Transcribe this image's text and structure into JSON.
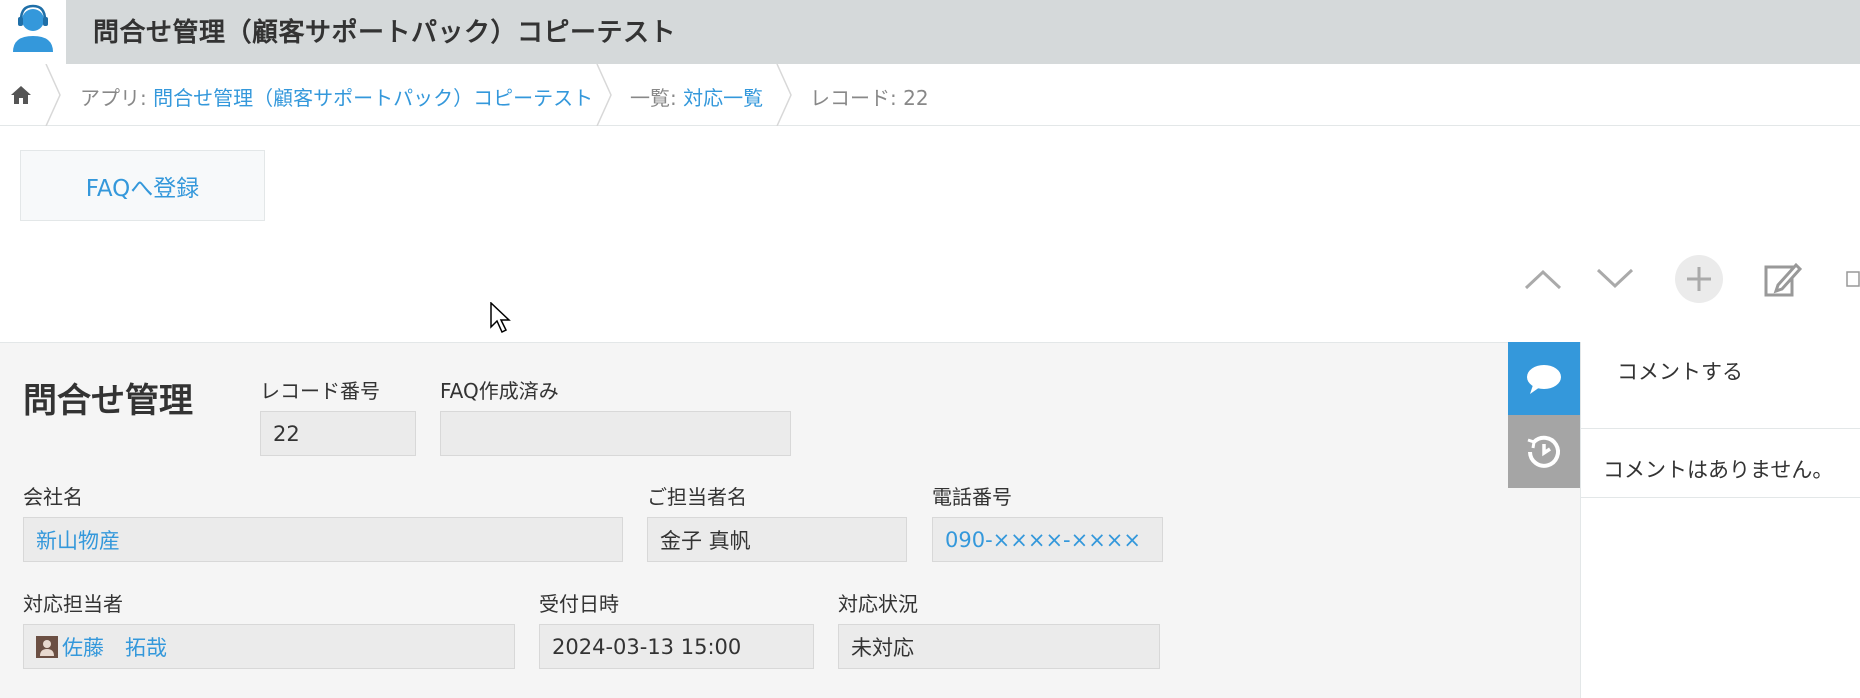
{
  "app": {
    "title": "問合せ管理（顧客サポートパック）コピーテスト"
  },
  "breadcrumb": {
    "app_prefix": "アプリ: ",
    "app_name": "問合せ管理（顧客サポートパック）コピーテスト",
    "view_prefix": "一覧: ",
    "view_name": "対応一覧",
    "record": "レコード: 22"
  },
  "actions": {
    "faq_button": "FAQへ登録"
  },
  "record": {
    "title": "問合せ管理",
    "fields": {
      "record_number": {
        "label": "レコード番号",
        "value": "22"
      },
      "faq_done": {
        "label": "FAQ作成済み",
        "value": ""
      },
      "company": {
        "label": "会社名",
        "value": "新山物産"
      },
      "contact": {
        "label": "ご担当者名",
        "value": "金子 真帆"
      },
      "phone": {
        "label": "電話番号",
        "value": "090-××××-××××"
      },
      "assignee": {
        "label": "対応担当者",
        "value": "佐藤　拓哉"
      },
      "received": {
        "label": "受付日時",
        "value": "2024-03-13 15:00"
      },
      "status": {
        "label": "対応状況",
        "value": "未対応"
      }
    }
  },
  "comments": {
    "action": "コメントする",
    "empty": "コメントはありません。"
  },
  "colors": {
    "header_bg": "#d5d9da",
    "link": "#3498db",
    "comment_tab": "#3498db",
    "history_tab": "#a5a5a5"
  },
  "icons": [
    "user-support-icon",
    "home-icon",
    "chevron-up-icon",
    "chevron-down-icon",
    "plus-icon",
    "edit-icon",
    "comment-icon",
    "history-icon",
    "user-icon"
  ]
}
